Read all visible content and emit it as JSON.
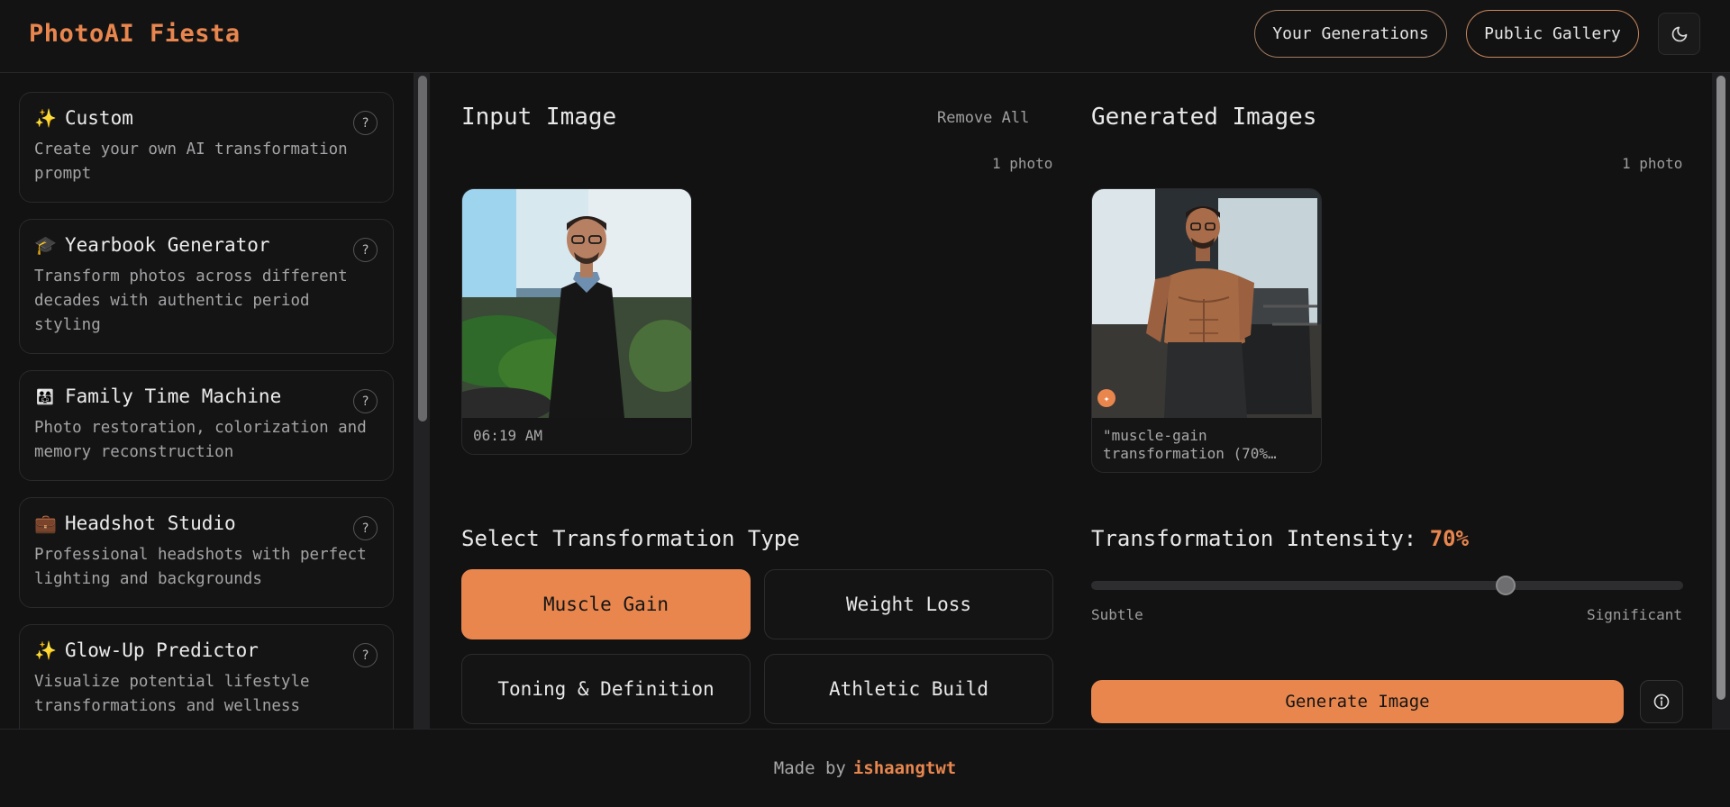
{
  "header": {
    "brand": "PhotoAI Fiesta",
    "your_generations": "Your Generations",
    "public_gallery": "Public Gallery",
    "theme_icon": "moon-icon"
  },
  "sidebar": {
    "items": [
      {
        "emoji": "✨",
        "title": "Custom",
        "desc": "Create your own AI transformation prompt",
        "help": "?"
      },
      {
        "emoji": "🎓",
        "title": "Yearbook Generator",
        "desc": "Transform photos across different decades with authentic period styling",
        "help": "?"
      },
      {
        "emoji": "👨‍👩‍👧",
        "title": "Family Time Machine",
        "desc": "Photo restoration, colorization and memory reconstruction",
        "help": "?"
      },
      {
        "emoji": "💼",
        "title": "Headshot Studio",
        "desc": "Professional headshots with perfect lighting and backgrounds",
        "help": "?"
      },
      {
        "emoji": "✨",
        "title": "Glow-Up Predictor",
        "desc": "Visualize potential lifestyle transformations and wellness",
        "help": "?"
      }
    ]
  },
  "input": {
    "title": "Input Image",
    "remove_all": "Remove All",
    "count": "1 photo",
    "photo_time": "06:19 AM"
  },
  "generated": {
    "title": "Generated Images",
    "count": "1 photo",
    "caption": "\"muscle-gain transformation (70%…"
  },
  "transform": {
    "title": "Select Transformation Type",
    "options": [
      "Muscle Gain",
      "Weight Loss",
      "Toning & Definition",
      "Athletic Build"
    ],
    "selected": "Muscle Gain"
  },
  "intensity": {
    "label": "Transformation Intensity:",
    "value_text": "70%",
    "value": 0.7,
    "min_label": "Subtle",
    "max_label": "Significant"
  },
  "actions": {
    "generate": "Generate Image",
    "info_icon": "info-icon"
  },
  "footer": {
    "made_by": "Made by",
    "author": "ishaangtwt"
  },
  "colors": {
    "accent": "#e8864e",
    "background": "#121213"
  }
}
